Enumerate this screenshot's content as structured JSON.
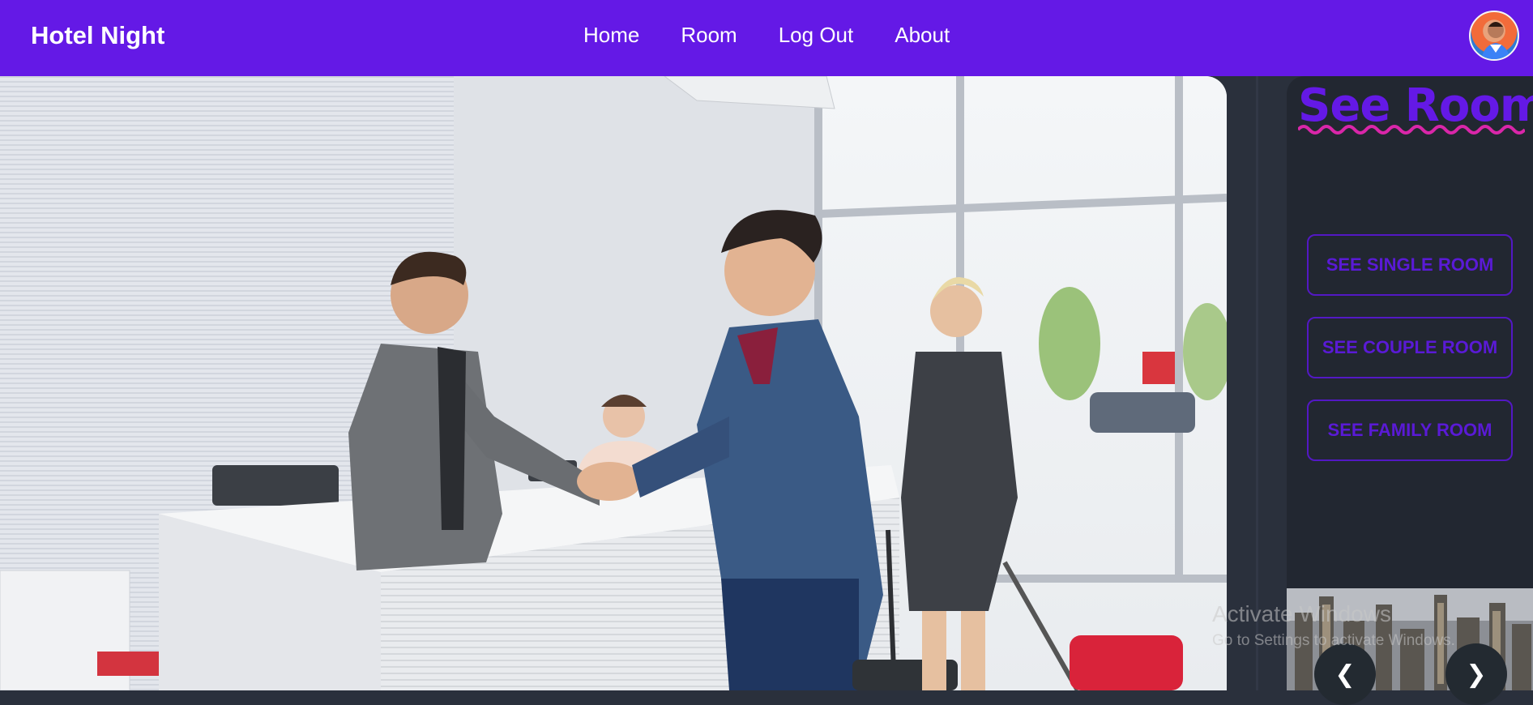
{
  "navbar": {
    "brand": "Hotel Night",
    "links": [
      "Home",
      "Room",
      "Log Out",
      "About"
    ]
  },
  "side_panel": {
    "title": "See Room",
    "buttons": [
      "SEE SINGLE ROOM",
      "SEE COUPLE ROOM",
      "SEE FAMILY ROOM"
    ],
    "carousel_prev": "❮",
    "carousel_next": "❯"
  },
  "watermark": {
    "line1": "Activate Windows",
    "line2": "Go to Settings to activate Windows."
  },
  "colors": {
    "primary": "#6419e6",
    "panel_bg": "#222731",
    "page_bg": "#2a303c",
    "title_underline": "#d926a9"
  }
}
